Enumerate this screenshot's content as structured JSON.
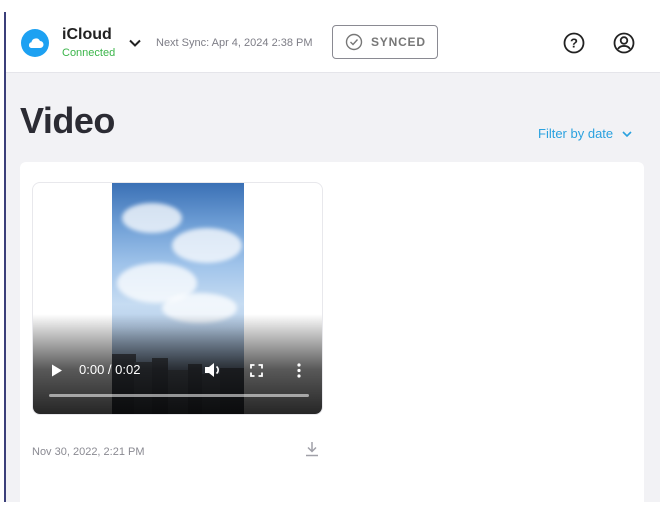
{
  "header": {
    "account": {
      "name": "iCloud",
      "status": "Connected"
    },
    "next_sync": "Next Sync: Apr 4, 2024 2:38 PM",
    "sync_button": "SYNCED"
  },
  "main": {
    "title": "Video",
    "filter_label": "Filter by date"
  },
  "video": {
    "time": "0:00 / 0:02",
    "progress": 0,
    "date": "Nov 30, 2022, 2:21 PM"
  },
  "colors": {
    "accent": "#2aa1df",
    "connected": "#3bb54a",
    "cloud_badge": "#1da1f2"
  },
  "icons": [
    "cloud-icon",
    "chevron-down-icon",
    "check-circle-icon",
    "help-icon",
    "user-icon",
    "play-icon",
    "volume-icon",
    "fullscreen-icon",
    "more-vertical-icon",
    "download-icon"
  ]
}
